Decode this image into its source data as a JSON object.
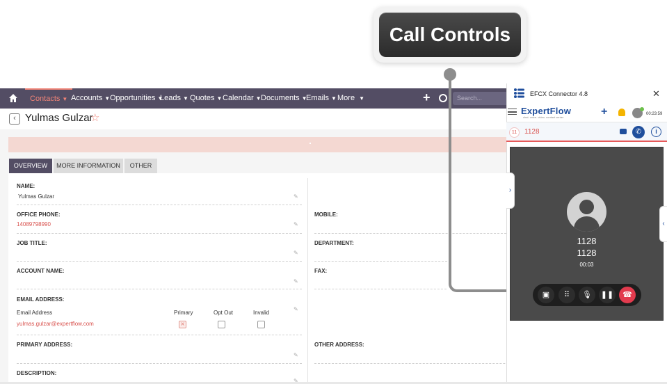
{
  "callout": {
    "label": "Call Controls"
  },
  "nav": {
    "items": [
      {
        "label": "Contacts",
        "active": true
      },
      {
        "label": "Accounts"
      },
      {
        "label": "Opportunities"
      },
      {
        "label": "Leads"
      },
      {
        "label": "Quotes"
      },
      {
        "label": "Calendar"
      },
      {
        "label": "Documents"
      },
      {
        "label": "Emails"
      },
      {
        "label": "More"
      }
    ],
    "search_placeholder": "Search..."
  },
  "record": {
    "title": "Yulmas Gulzar",
    "tabs": [
      "OVERVIEW",
      "MORE INFORMATION",
      "OTHER"
    ],
    "fields": {
      "name_label": "NAME:",
      "name_value": "Yulmas Gulzar",
      "office_phone_label": "OFFICE PHONE:",
      "office_phone_value": "14089798990",
      "mobile_label": "MOBILE:",
      "job_title_label": "JOB TITLE:",
      "department_label": "DEPARTMENT:",
      "account_name_label": "ACCOUNT NAME:",
      "fax_label": "FAX:",
      "email_address_label": "EMAIL ADDRESS:",
      "email_col_address": "Email Address",
      "email_col_primary": "Primary",
      "email_col_optout": "Opt Out",
      "email_col_invalid": "Invalid",
      "email_value": "yulmas.gulzar@expertflow.com",
      "primary_address_label": "PRIMARY ADDRESS:",
      "other_address_label": "OTHER ADDRESS:",
      "description_label": "DESCRIPTION:"
    }
  },
  "connector": {
    "title": "EFCX Connector 4.8",
    "brand": "ExpertFlow",
    "brand_sub": "chat. voice. video. contact center",
    "timer": "00:23:59",
    "call_count": "11",
    "call_number": "1128",
    "card": {
      "name": "1128",
      "number": "1128",
      "duration": "00:03"
    }
  },
  "colors": {
    "nav_bg": "#534d64",
    "accent": "#f08377",
    "brand_blue": "#1f4e9c",
    "end_call": "#e23b4e"
  }
}
